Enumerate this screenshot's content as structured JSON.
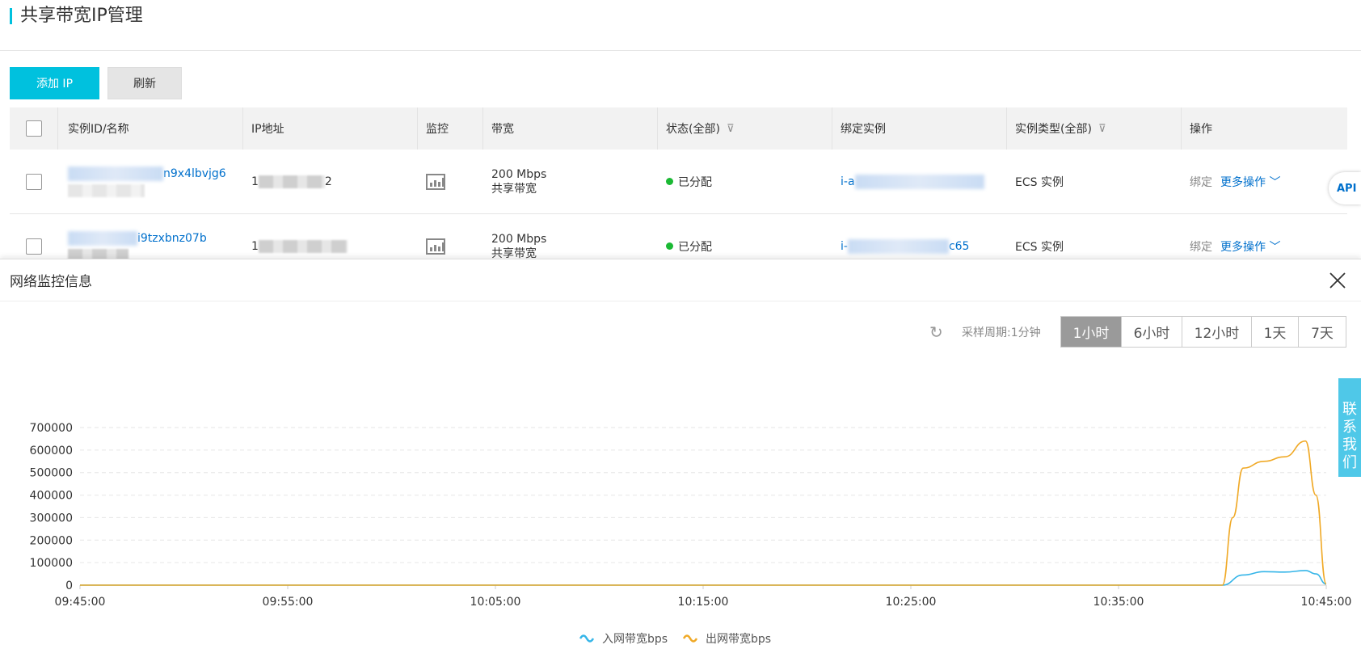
{
  "header": {
    "title": "共享带宽IP管理"
  },
  "toolbar": {
    "add_ip": "添加 IP",
    "refresh": "刷新"
  },
  "table": {
    "columns": [
      "实例ID/名称",
      "IP地址",
      "监控",
      "带宽",
      "状态(全部)",
      "绑定实例",
      "实例类型(全部)",
      "操作"
    ],
    "rows": [
      {
        "id": "n9x4lbvjg6",
        "ip_prefix": "1",
        "ip_suffix": "2",
        "bandwidth": "200 Mbps",
        "bandwidth_type": "共享带宽",
        "status": "已分配",
        "instance_prefix": "i-a",
        "instance_suffix": "",
        "instance_type": "ECS 实例",
        "bind": "绑定",
        "more": "更多操作"
      },
      {
        "id": "i9tzxbnz07b",
        "ip_prefix": "1",
        "ip_suffix": "",
        "bandwidth": "200 Mbps",
        "bandwidth_type": "共享带宽",
        "status": "已分配",
        "instance_prefix": "i-",
        "instance_suffix": "c65",
        "instance_type": "ECS 实例",
        "bind": "绑定",
        "more": "更多操作"
      }
    ]
  },
  "panel": {
    "title": "网络监控信息",
    "period_label": "采样周期:1分钟",
    "time_ranges": [
      "1小时",
      "6小时",
      "12小时",
      "1天",
      "7天"
    ],
    "active_range": "1小时"
  },
  "side": {
    "api": "API",
    "contact": [
      "联",
      "系",
      "我",
      "们"
    ]
  },
  "colors": {
    "accent": "#00c1de",
    "link": "#0070cc",
    "in_series": "#35b5e8",
    "out_series": "#f0a926"
  },
  "chart_data": {
    "type": "line",
    "y_ticks": [
      0,
      100000,
      200000,
      300000,
      400000,
      500000,
      600000,
      700000
    ],
    "x_ticks": [
      "09:45:00",
      "09:55:00",
      "10:05:00",
      "10:15:00",
      "10:25:00",
      "10:35:00",
      "10:45:00"
    ],
    "ylim": [
      0,
      700000
    ],
    "grid": true,
    "legend_position": "bottom-center",
    "series": [
      {
        "name": "入网带宽bps",
        "points": [
          [
            "09:45:00",
            0
          ],
          [
            "10:39:00",
            0
          ],
          [
            "10:40:00",
            0
          ],
          [
            "10:41:00",
            45000
          ],
          [
            "10:42:00",
            60000
          ],
          [
            "10:43:00",
            58000
          ],
          [
            "10:44:00",
            65000
          ],
          [
            "10:44:30",
            50000
          ],
          [
            "10:45:00",
            5000
          ]
        ]
      },
      {
        "name": "出网带宽bps",
        "points": [
          [
            "09:45:00",
            0
          ],
          [
            "10:39:00",
            0
          ],
          [
            "10:40:00",
            0
          ],
          [
            "10:40:30",
            300000
          ],
          [
            "10:41:00",
            520000
          ],
          [
            "10:42:00",
            550000
          ],
          [
            "10:43:00",
            570000
          ],
          [
            "10:44:00",
            640000
          ],
          [
            "10:44:30",
            400000
          ],
          [
            "10:45:00",
            5000
          ]
        ]
      }
    ]
  }
}
